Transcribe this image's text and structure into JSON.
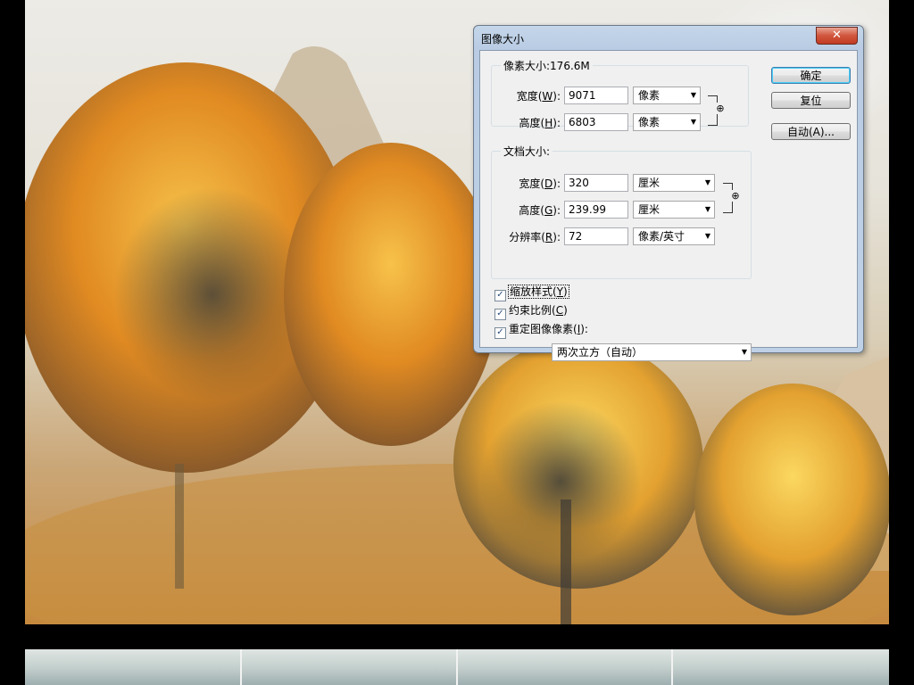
{
  "dialog": {
    "title": "图像大小",
    "close_label": "✕"
  },
  "pixel_dimensions": {
    "legend": "像素大小:176.6M",
    "width_label_prefix": "宽度(",
    "width_label_key": "W",
    "width_label_suffix": "):",
    "width_value": "9071",
    "width_unit": "像素",
    "height_label_prefix": "高度(",
    "height_label_key": "H",
    "height_label_suffix": "):",
    "height_value": "6803",
    "height_unit": "像素"
  },
  "document_size": {
    "legend": "文档大小:",
    "width_label_prefix": "宽度(",
    "width_label_key": "D",
    "width_label_suffix": "):",
    "width_value": "320",
    "width_unit": "厘米",
    "height_label_prefix": "高度(",
    "height_label_key": "G",
    "height_label_suffix": "):",
    "height_value": "239.99",
    "height_unit": "厘米",
    "resolution_label_prefix": "分辨率(",
    "resolution_label_key": "R",
    "resolution_label_suffix": "):",
    "resolution_value": "72",
    "resolution_unit": "像素/英寸"
  },
  "buttons": {
    "ok": "确定",
    "reset": "复位",
    "auto": "自动(A)..."
  },
  "options": {
    "scale_styles": {
      "prefix": "缩放样式(",
      "key": "Y",
      "suffix": ")",
      "checked": true
    },
    "constrain_proportions": {
      "prefix": "约束比例(",
      "key": "C",
      "suffix": ")",
      "checked": true
    },
    "resample_image": {
      "prefix": "重定图像像素(",
      "key": "I",
      "suffix": "):",
      "checked": true
    },
    "resample_method": "两次立方（自动）"
  },
  "icons": {
    "chain": "link-chain-icon",
    "dropdown": "chevron-down-icon",
    "check": "checkmark-icon"
  },
  "colors": {
    "titlebar": "#b9cce3",
    "close_button": "#c13a22",
    "default_button_border": "#3c7fb1",
    "dialog_client": "#f0f0f0"
  }
}
